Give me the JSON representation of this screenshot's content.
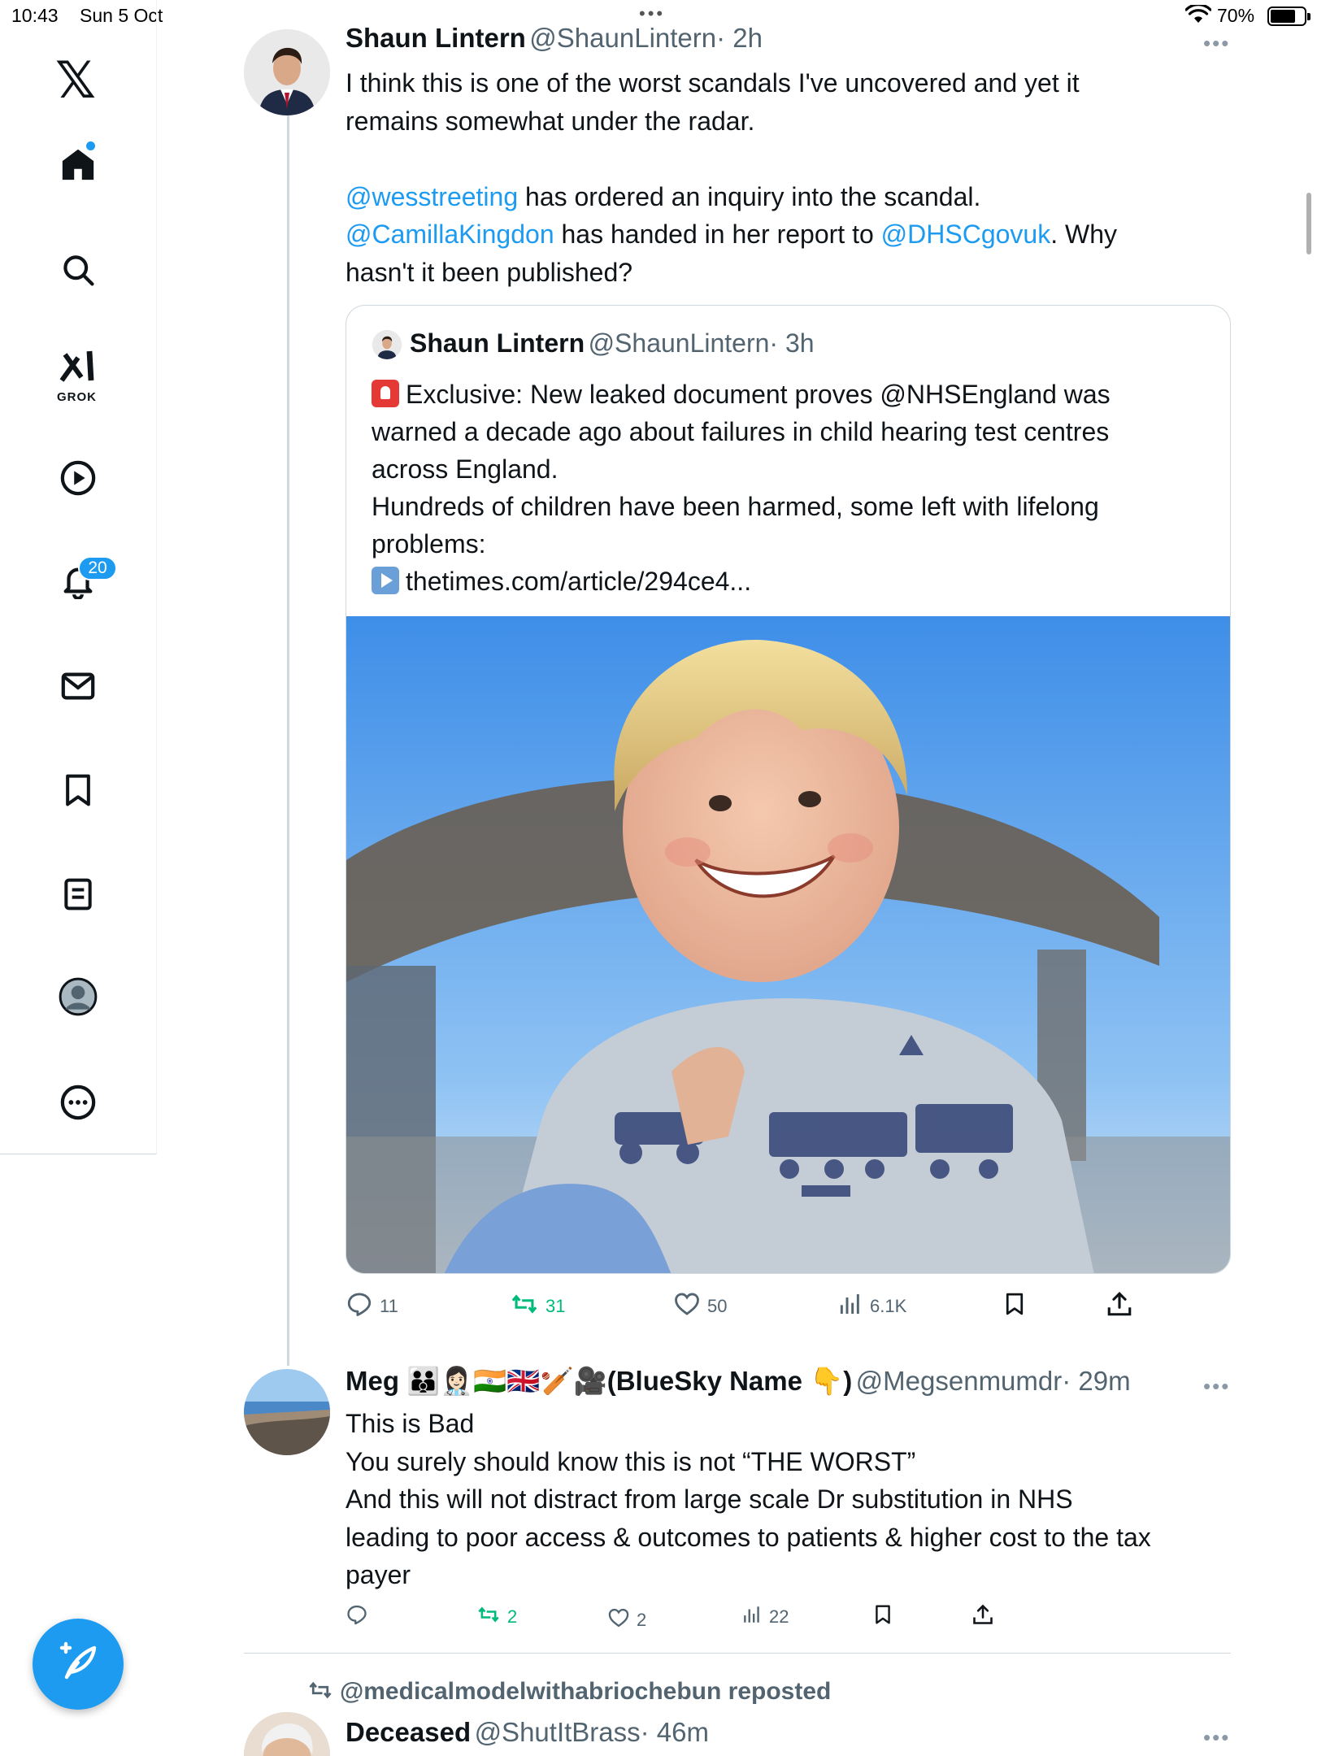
{
  "status_bar": {
    "time": "10:43",
    "date": "Sun 5 Oct",
    "battery": "70%",
    "battery_level": 0.7
  },
  "sidebar": {
    "logo": "𝕏",
    "grok_label": "GROK",
    "notifications_count": "20",
    "items": [
      {
        "name": "home-icon"
      },
      {
        "name": "search-icon"
      },
      {
        "name": "grok-icon"
      },
      {
        "name": "video-icon"
      },
      {
        "name": "bell-icon"
      },
      {
        "name": "mail-icon"
      },
      {
        "name": "bookmark-icon"
      },
      {
        "name": "lists-icon"
      },
      {
        "name": "profile-icon"
      },
      {
        "name": "more-icon"
      }
    ],
    "compose_icon": "compose-icon"
  },
  "main_tweet": {
    "name": "Shaun Lintern",
    "handle": "@ShaunLintern",
    "time": "· 2h",
    "line1": "I think this is one of the worst scandals I've uncovered and yet it",
    "line2": "remains somewhat under the radar.",
    "mention1": "@wesstreeting",
    "text_a": " has ordered an inquiry into the scandal.",
    "mention2": "@CamillaKingdon",
    "text_b": " has handed in her report to ",
    "mention3": "@DHSCgovuk",
    "text_c": ". Why",
    "line_last": "hasn't it been published?",
    "quote": {
      "name": "Shaun Lintern",
      "handle": "@ShaunLintern",
      "time": "· 3h",
      "line1": "Exclusive: New leaked document proves @NHSEngland was",
      "line2": "warned a decade ago about failures in child hearing test centres",
      "line3": "across England.",
      "line4": "Hundreds of children have been harmed, some left with lifelong",
      "line5": "problems:",
      "link": "thetimes.com/article/294ce4..."
    },
    "actions": {
      "replies": "11",
      "reposts": "31",
      "likes": "50",
      "views": "6.1K"
    }
  },
  "reply": {
    "name": "Meg 👪👩🏻‍⚕️🇮🇳🇬🇧🏏🎥(BlueSky Name 👇)",
    "handle": "@Megsenmumdr",
    "time": "· 29m",
    "line1": "This is Bad",
    "line2": "You surely should know this is not “THE WORST”",
    "line3": "And this will not distract from large scale Dr substitution in NHS",
    "line4": "leading to poor access & outcomes to patients & higher cost to the tax",
    "line5": "payer",
    "actions": {
      "reposts": "2",
      "likes": "2",
      "views": "22"
    }
  },
  "next_tweet": {
    "repost_label": "@medicalmodelwithabriochebun reposted",
    "name": "Deceased",
    "handle": "@ShutItBrass",
    "time": "· 46m"
  },
  "colors": {
    "accent": "#1d9bf0",
    "repost_green": "#00ba7c",
    "muted": "#536471"
  }
}
